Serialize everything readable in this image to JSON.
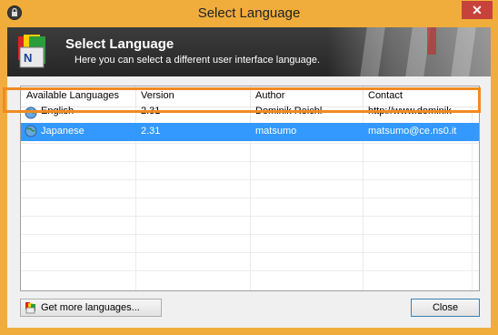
{
  "window": {
    "title": "Select Language",
    "close_glyph": "✕"
  },
  "banner": {
    "title": "Select Language",
    "subtitle": "Here you can select a different user interface language."
  },
  "table": {
    "columns": [
      "Available Languages",
      "Version",
      "Author",
      "Contact"
    ],
    "rows": [
      {
        "language": "English",
        "version": "2.31",
        "author": "Dominik Reichl",
        "contact": "http://www.dominik-",
        "selected": false,
        "icon": "globe-icon"
      },
      {
        "language": "Japanese",
        "version": "2.31",
        "author": "matsumo",
        "contact": "matsumo@ce.ns0.it",
        "selected": true,
        "icon": "globe-icon"
      }
    ]
  },
  "buttons": {
    "get_more": "Get more languages...",
    "close": "Close"
  },
  "colors": {
    "title_bar": "#f0ad3c",
    "banner": "#2f2f2f",
    "selection": "#3399ff",
    "highlight": "#f08a24"
  }
}
